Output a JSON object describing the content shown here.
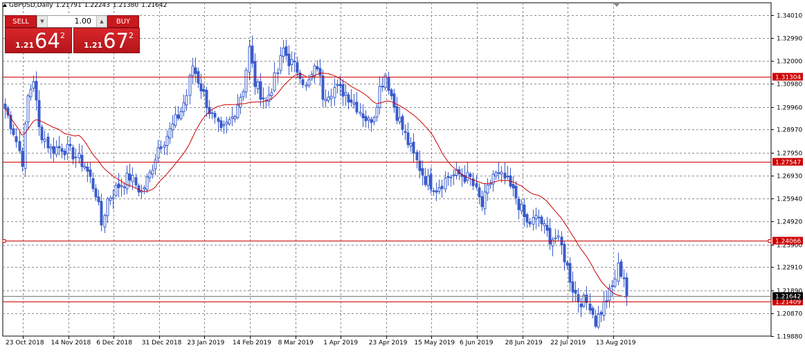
{
  "header": {
    "symbol": "GBPUSD,Daily",
    "open": "1.21791",
    "high": "1.22243",
    "low": "1.21380",
    "close": "1.21642"
  },
  "trade_panel": {
    "sell_label": "SELL",
    "buy_label": "BUY",
    "lot_value": "1.00",
    "sell_price_prefix": "1.21",
    "sell_price_big": "64",
    "sell_price_sup": "2",
    "buy_price_prefix": "1.21",
    "buy_price_big": "67",
    "buy_price_sup": "2"
  },
  "colors": {
    "candle": "#3a5ccc",
    "ma": "#cc0000",
    "hline": "#cc0000",
    "grid": "#8c8c8c",
    "price_tag_bg": "#cc0000",
    "current_tag_bg": "#000000"
  },
  "chart_data": {
    "type": "candlestick",
    "title": "GBPUSD,Daily",
    "ylim": [
      1.1988,
      1.3455
    ],
    "y_ticks": [
      "1.34010",
      "1.32990",
      "1.32000",
      "1.30980",
      "1.29960",
      "1.28970",
      "1.27950",
      "1.26930",
      "1.25940",
      "1.24920",
      "1.23900",
      "1.22910",
      "1.21890",
      "1.20870",
      "1.19880"
    ],
    "x_ticks": [
      "23 Oct 2018",
      "14 Nov 2018",
      "6 Dec 2018",
      "31 Dec 2018",
      "23 Jan 2019",
      "14 Feb 2019",
      "8 Mar 2019",
      "1 Apr 2019",
      "23 Apr 2019",
      "15 May 2019",
      "6 Jun 2019",
      "28 Jun 2019",
      "22 Jul 2019",
      "13 Aug 2019"
    ],
    "x_tick_index": [
      0,
      16,
      32,
      48,
      64,
      80,
      96,
      112,
      128,
      144,
      160,
      176,
      192,
      208
    ],
    "horizontal_lines": [
      {
        "value": 1.31304,
        "label": "1.31304"
      },
      {
        "value": 1.27547,
        "label": "1.27547"
      },
      {
        "value": 1.24066,
        "label": "1.24066"
      },
      {
        "value": 1.21409,
        "label": "1.21409"
      }
    ],
    "current_price": {
      "value": 1.21642,
      "label": "1.21642"
    },
    "moving_average": "red line",
    "close_anchors": [
      [
        0,
        1.299
      ],
      [
        3,
        1.289
      ],
      [
        6,
        1.276
      ],
      [
        8,
        1.304
      ],
      [
        10,
        1.312
      ],
      [
        12,
        1.29
      ],
      [
        16,
        1.281
      ],
      [
        20,
        1.282
      ],
      [
        24,
        1.279
      ],
      [
        28,
        1.274
      ],
      [
        32,
        1.262
      ],
      [
        34,
        1.248
      ],
      [
        36,
        1.259
      ],
      [
        40,
        1.265
      ],
      [
        44,
        1.269
      ],
      [
        48,
        1.262
      ],
      [
        51,
        1.27
      ],
      [
        54,
        1.282
      ],
      [
        58,
        1.289
      ],
      [
        62,
        1.298
      ],
      [
        64,
        1.305
      ],
      [
        66,
        1.318
      ],
      [
        70,
        1.305
      ],
      [
        72,
        1.298
      ],
      [
        76,
        1.288
      ],
      [
        80,
        1.295
      ],
      [
        84,
        1.308
      ],
      [
        86,
        1.325
      ],
      [
        88,
        1.31
      ],
      [
        92,
        1.302
      ],
      [
        96,
        1.315
      ],
      [
        98,
        1.325
      ],
      [
        100,
        1.32
      ],
      [
        104,
        1.315
      ],
      [
        106,
        1.308
      ],
      [
        110,
        1.318
      ],
      [
        112,
        1.305
      ],
      [
        116,
        1.308
      ],
      [
        120,
        1.306
      ],
      [
        124,
        1.3
      ],
      [
        128,
        1.293
      ],
      [
        130,
        1.297
      ],
      [
        132,
        1.308
      ],
      [
        134,
        1.314
      ],
      [
        137,
        1.3
      ],
      [
        140,
        1.29
      ],
      [
        144,
        1.278
      ],
      [
        148,
        1.268
      ],
      [
        152,
        1.264
      ],
      [
        156,
        1.269
      ],
      [
        160,
        1.27
      ],
      [
        164,
        1.268
      ],
      [
        168,
        1.256
      ],
      [
        172,
        1.27
      ],
      [
        176,
        1.268
      ],
      [
        180,
        1.26
      ],
      [
        184,
        1.248
      ],
      [
        188,
        1.251
      ],
      [
        190,
        1.246
      ],
      [
        192,
        1.242
      ],
      [
        194,
        1.242
      ],
      [
        196,
        1.238
      ],
      [
        198,
        1.229
      ],
      [
        200,
        1.22
      ],
      [
        202,
        1.215
      ],
      [
        206,
        1.213
      ],
      [
        208,
        1.205
      ],
      [
        210,
        1.21
      ],
      [
        212,
        1.215
      ],
      [
        214,
        1.22
      ],
      [
        216,
        1.229
      ],
      [
        218,
        1.225
      ],
      [
        219,
        1.2164
      ]
    ]
  }
}
